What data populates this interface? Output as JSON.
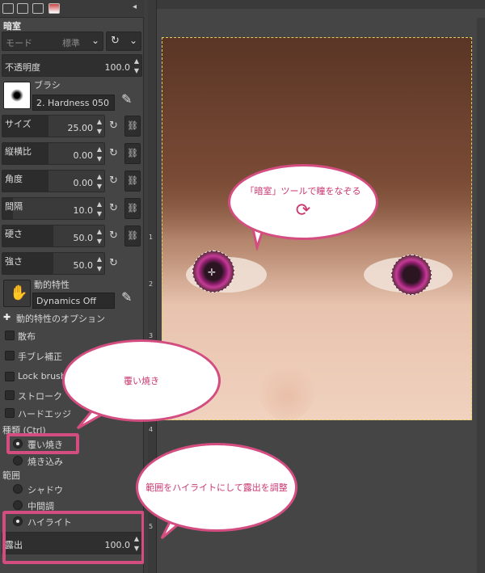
{
  "panel": {
    "title": "暗室",
    "mode": {
      "label": "モード",
      "value": "標準"
    },
    "opacity": {
      "label": "不透明度",
      "value": "100.0"
    },
    "brush": {
      "label": "ブラシ",
      "name": "2. Hardness 050"
    },
    "params": [
      {
        "label": "サイズ",
        "value": "25.00",
        "fill": 0.45
      },
      {
        "label": "縦横比",
        "value": "0.00",
        "fill": 0.45
      },
      {
        "label": "角度",
        "value": "0.00",
        "fill": 0.45
      },
      {
        "label": "間隔",
        "value": "10.0",
        "fill": 0.1
      },
      {
        "label": "硬さ",
        "value": "50.0",
        "fill": 0.5
      },
      {
        "label": "強さ",
        "value": "50.0",
        "fill": 0.5
      }
    ],
    "dynamics": {
      "label": "動的特性",
      "value": "Dynamics Off"
    },
    "dynamics_options": "動的特性のオプション",
    "checks": [
      "散布",
      "手ブレ補正",
      "Lock brush",
      "ストローク",
      "ハードエッジ"
    ],
    "type_label": "種類 (Ctrl)",
    "type_options": [
      {
        "label": "覆い焼き",
        "on": true
      },
      {
        "label": "焼き込み",
        "on": false
      }
    ],
    "range_label": "範囲",
    "range_options": [
      {
        "label": "シャドウ",
        "on": false
      },
      {
        "label": "中間調",
        "on": false
      },
      {
        "label": "ハイライト",
        "on": true
      }
    ],
    "exposure": {
      "label": "露出",
      "value": "100.0"
    }
  },
  "ruler_ticks": [
    "1",
    "2",
    "3",
    "4",
    "5"
  ],
  "bubbles": {
    "tool_tip": "「暗室」ツールで瞳をなぞる",
    "dodge": "覆い焼き",
    "range_tip": "範囲をハイライトにして露出を調整"
  },
  "colors": {
    "accent": "#d44d81",
    "bubble_text": "#c9366e",
    "panel_bg": "#454545"
  }
}
